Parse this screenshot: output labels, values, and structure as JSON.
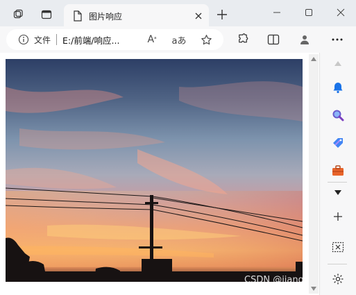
{
  "tab": {
    "title": "图片响应"
  },
  "address": {
    "info_label": "文件",
    "url": "E:/前端/响应..."
  },
  "watermark": "CSDN @jiangchuxiu",
  "icons": {
    "workspaces": "workspaces-icon",
    "vertical_tabs": "tab-actions-icon",
    "page": "page-icon",
    "close_tab": "close-icon",
    "new_tab": "plus-icon",
    "minimize": "minimize-icon",
    "maximize": "maximize-icon",
    "close_window": "close-icon",
    "info": "info-icon",
    "read_aloud": "read-aloud-icon",
    "translate": "translate-icon",
    "favorite": "star-icon",
    "extensions": "puzzle-icon",
    "split": "split-screen-icon",
    "profile": "profile-icon",
    "more": "more-icon"
  },
  "sidebar": {
    "items": [
      "bell-icon",
      "search-icon",
      "tag-icon",
      "toolbox-icon",
      "dropdown-icon",
      "add-icon",
      "screenshot-icon",
      "settings-icon"
    ]
  },
  "colors": {
    "accent_blue": "#1a73e8",
    "frame": "#e9ecf0",
    "toolbar": "#f7f7f8"
  }
}
